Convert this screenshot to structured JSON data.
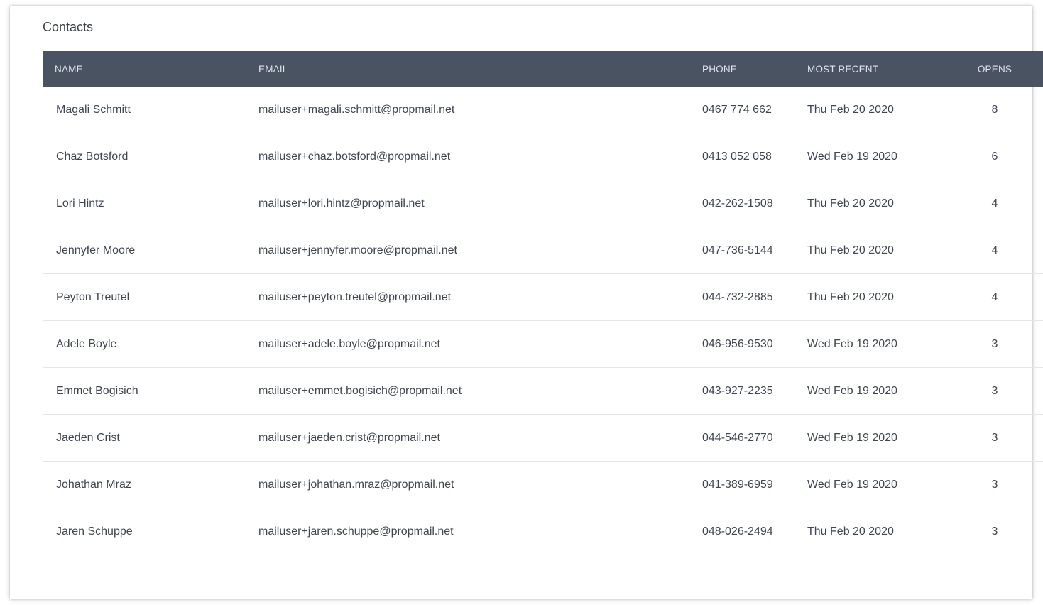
{
  "card": {
    "title": "Contacts"
  },
  "table": {
    "columns": {
      "name": "NAME",
      "email": "EMAIL",
      "phone": "PHONE",
      "recent": "MOST RECENT",
      "opens": "OPENS"
    },
    "rows": [
      {
        "name": "Magali Schmitt",
        "email": "mailuser+magali.schmitt@propmail.net",
        "phone": "0467 774 662",
        "recent": "Thu Feb 20 2020",
        "opens": "8"
      },
      {
        "name": "Chaz Botsford",
        "email": "mailuser+chaz.botsford@propmail.net",
        "phone": "0413 052 058",
        "recent": "Wed Feb 19 2020",
        "opens": "6"
      },
      {
        "name": "Lori Hintz",
        "email": "mailuser+lori.hintz@propmail.net",
        "phone": "042-262-1508",
        "recent": "Thu Feb 20 2020",
        "opens": "4"
      },
      {
        "name": "Jennyfer Moore",
        "email": "mailuser+jennyfer.moore@propmail.net",
        "phone": "047-736-5144",
        "recent": "Thu Feb 20 2020",
        "opens": "4"
      },
      {
        "name": "Peyton Treutel",
        "email": "mailuser+peyton.treutel@propmail.net",
        "phone": "044-732-2885",
        "recent": "Thu Feb 20 2020",
        "opens": "4"
      },
      {
        "name": "Adele Boyle",
        "email": "mailuser+adele.boyle@propmail.net",
        "phone": "046-956-9530",
        "recent": "Wed Feb 19 2020",
        "opens": "3"
      },
      {
        "name": "Emmet Bogisich",
        "email": "mailuser+emmet.bogisich@propmail.net",
        "phone": "043-927-2235",
        "recent": "Wed Feb 19 2020",
        "opens": "3"
      },
      {
        "name": "Jaeden Crist",
        "email": "mailuser+jaeden.crist@propmail.net",
        "phone": "044-546-2770",
        "recent": "Wed Feb 19 2020",
        "opens": "3"
      },
      {
        "name": "Johathan Mraz",
        "email": "mailuser+johathan.mraz@propmail.net",
        "phone": "041-389-6959",
        "recent": "Wed Feb 19 2020",
        "opens": "3"
      },
      {
        "name": "Jaren Schuppe",
        "email": "mailuser+jaren.schuppe@propmail.net",
        "phone": "048-026-2494",
        "recent": "Thu Feb 20 2020",
        "opens": "3"
      }
    ]
  }
}
